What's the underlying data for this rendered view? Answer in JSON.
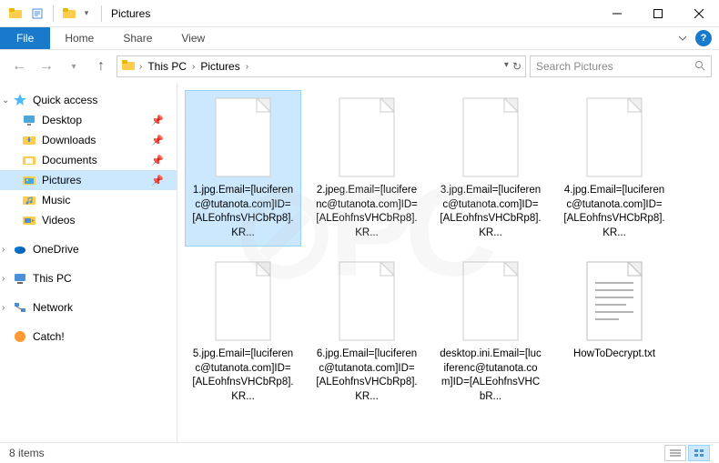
{
  "window": {
    "title": "Pictures"
  },
  "ribbon": {
    "file": "File",
    "tabs": [
      "Home",
      "Share",
      "View"
    ]
  },
  "breadcrumbs": [
    "This PC",
    "Pictures"
  ],
  "search": {
    "placeholder": "Search Pictures"
  },
  "sidebar": {
    "quick_access": {
      "label": "Quick access"
    },
    "quick_items": [
      {
        "label": "Desktop",
        "pin": true
      },
      {
        "label": "Downloads",
        "pin": true
      },
      {
        "label": "Documents",
        "pin": true
      },
      {
        "label": "Pictures",
        "pin": true,
        "selected": true
      },
      {
        "label": "Music",
        "pin": false
      },
      {
        "label": "Videos",
        "pin": false
      }
    ],
    "onedrive": {
      "label": "OneDrive"
    },
    "thispc": {
      "label": "This PC"
    },
    "network": {
      "label": "Network"
    },
    "catch": {
      "label": "Catch!"
    }
  },
  "files": [
    {
      "name": "1.jpg.Email=[luciferenc@tutanota.com]ID=[ALEohfnsVHCbRp8].KR...",
      "type": "blank",
      "selected": true
    },
    {
      "name": "2.jpeg.Email=[luciferenc@tutanota.com]ID=[ALEohfnsVHCbRp8].KR...",
      "type": "blank"
    },
    {
      "name": "3.jpg.Email=[luciferenc@tutanota.com]ID=[ALEohfnsVHCbRp8].KR...",
      "type": "blank"
    },
    {
      "name": "4.jpg.Email=[luciferenc@tutanota.com]ID=[ALEohfnsVHCbRp8].KR...",
      "type": "blank"
    },
    {
      "name": "5.jpg.Email=[luciferenc@tutanota.com]ID=[ALEohfnsVHCbRp8].KR...",
      "type": "blank"
    },
    {
      "name": "6.jpg.Email=[luciferenc@tutanota.com]ID=[ALEohfnsVHCbRp8].KR...",
      "type": "blank"
    },
    {
      "name": "desktop.ini.Email=[luciferenc@tutanota.com]ID=[ALEohfnsVHCbR...",
      "type": "blank"
    },
    {
      "name": "HowToDecrypt.txt",
      "type": "txt"
    }
  ],
  "status": {
    "items": "8 items"
  },
  "icons": {
    "folder_color": "#ffcc4d",
    "star_color": "#4db8ff"
  }
}
